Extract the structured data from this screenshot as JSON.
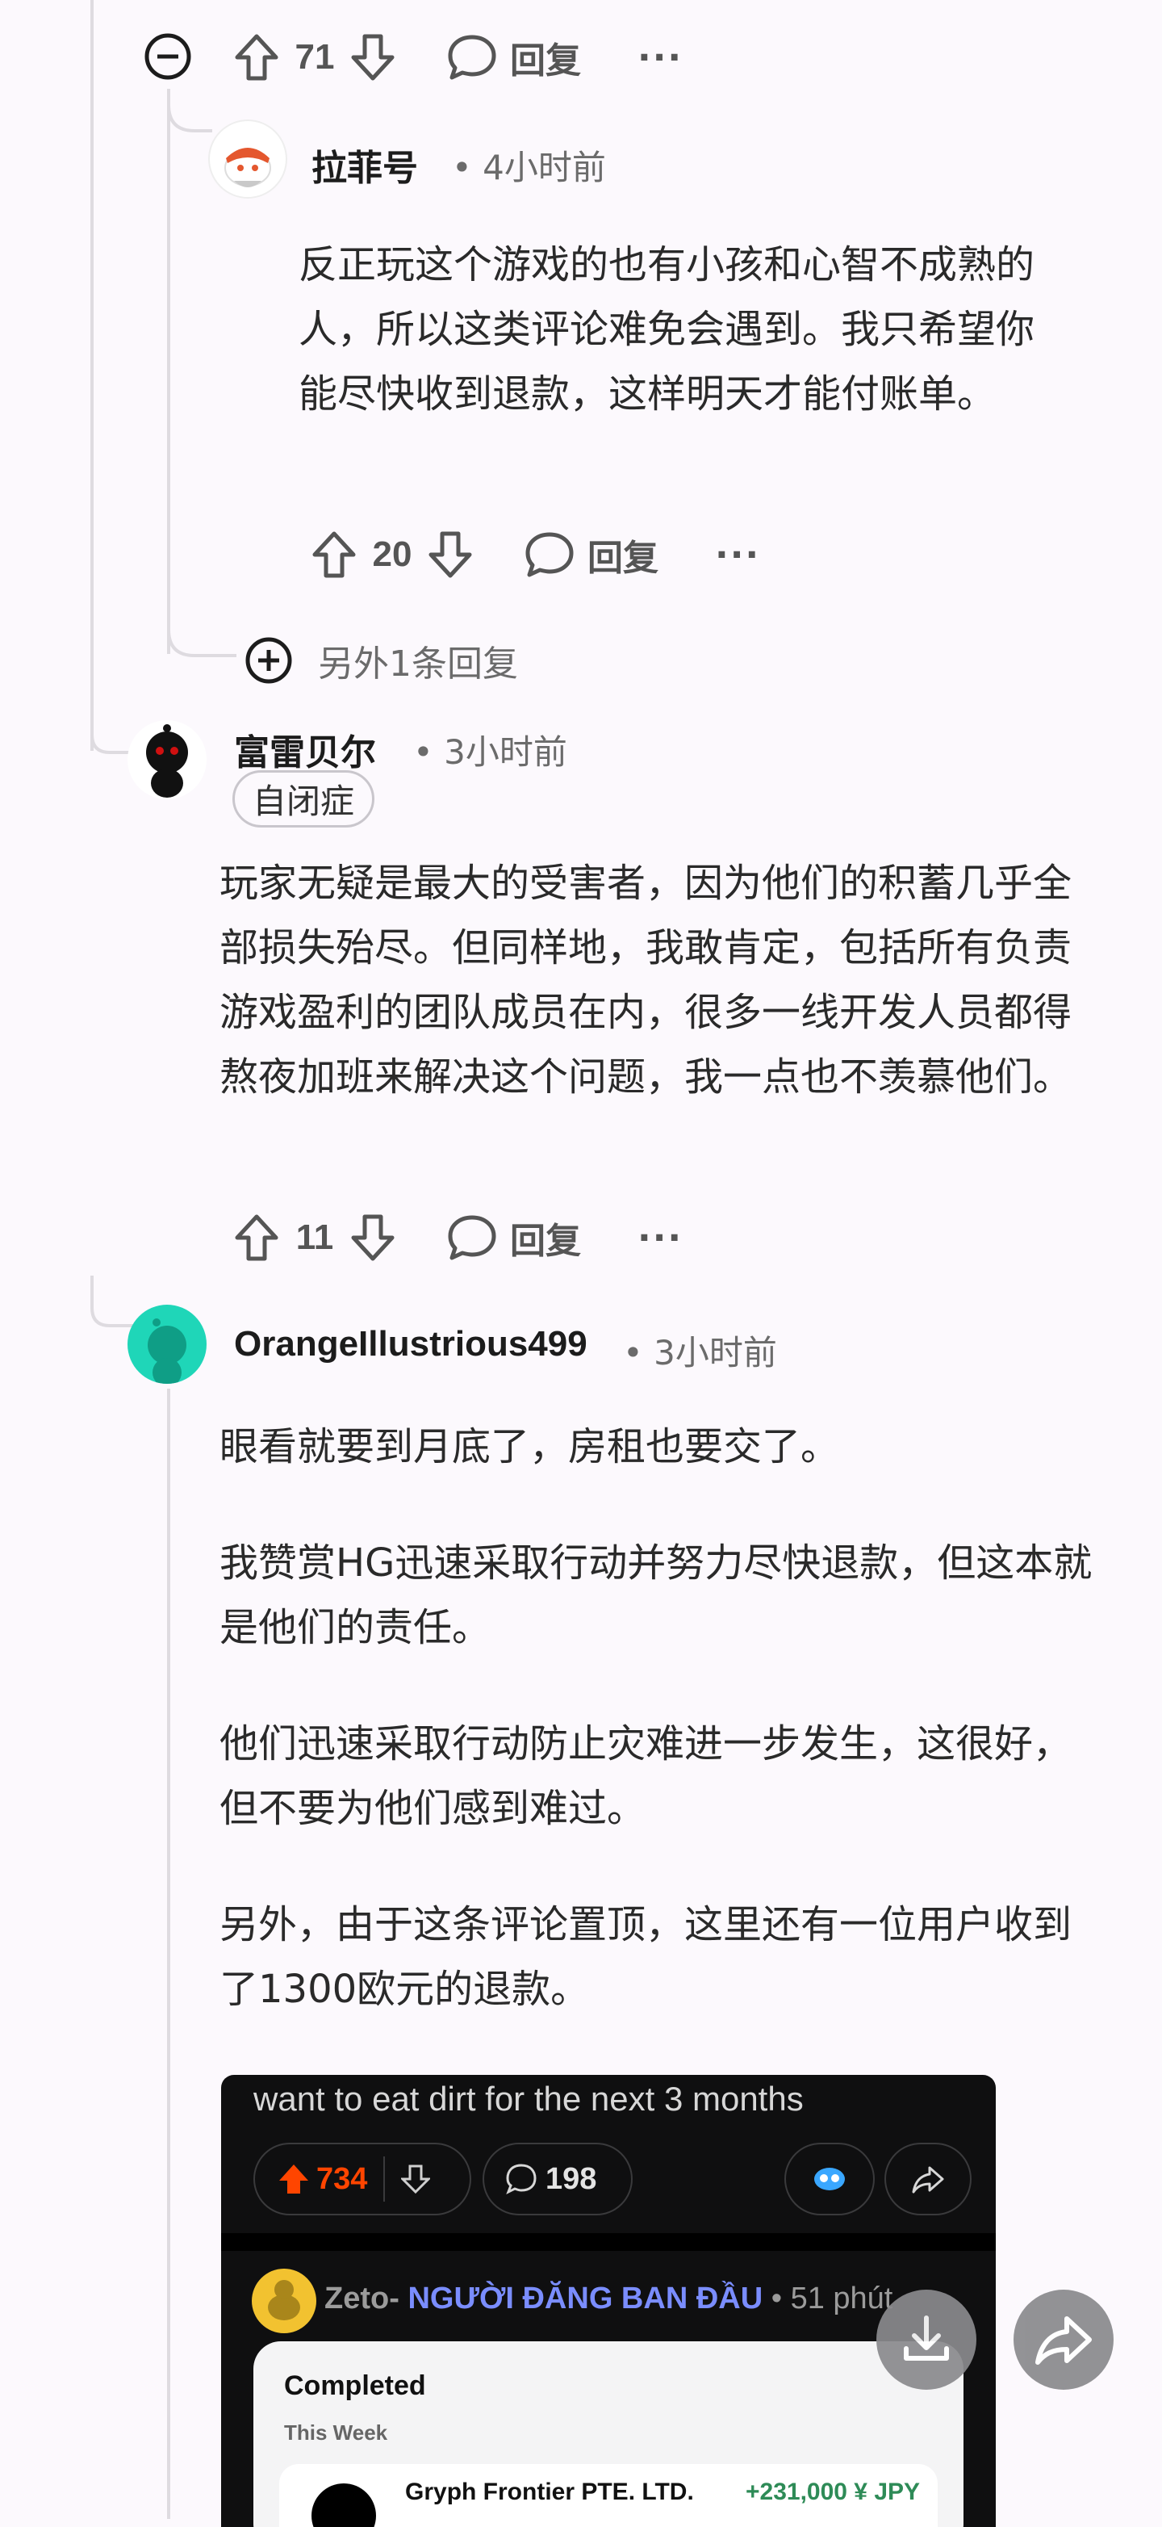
{
  "comments": [
    {
      "votes": "71",
      "reply_label": "回复",
      "more": "···"
    },
    {
      "username": "拉菲号",
      "time": "• 4小时前",
      "text": "反正玩这个游戏的也有小孩和心智不成熟的人，所以这类评论难免会遇到。我只希望你能尽快收到退款，这样明天才能付账单。",
      "votes": "20",
      "reply_label": "回复",
      "more": "···"
    },
    {
      "more_replies": "另外1条回复"
    },
    {
      "username": "富雷贝尔",
      "time": "• 3小时前",
      "flair": "自闭症",
      "text": "玩家无疑是最大的受害者，因为他们的积蓄几乎全部损失殆尽。但同样地，我敢肯定，包括所有负责游戏盈利的团队成员在内，很多一线开发人员都得熬夜加班来解决这个问题，我一点也不羡慕他们。",
      "votes": "11",
      "reply_label": "回复",
      "more": "···"
    },
    {
      "username": "OrangeIllustrious499",
      "time": "• 3小时前",
      "paragraphs": [
        "眼看就要到月底了，房租也要交了。",
        "我赞赏HG迅速采取行动并努力尽快退款，但这本就是他们的责任。",
        "他们迅速采取行动防止灾难进一步发生，这很好，但不要为他们感到难过。",
        "另外，由于这条评论置顶，这里还有一位用户收到了1300欧元的退款。"
      ]
    }
  ],
  "embed": {
    "title": "want to eat dirt for the next 3 months",
    "upvotes": "734",
    "comments": "198",
    "author": "Zeto-",
    "op_badge": "NGƯỜI ĐĂNG BAN ĐẦU",
    "time": "• 51 phút",
    "card_title": "Completed",
    "card_subtitle": "This Week",
    "tx_name": "Gryph Frontier PTE. LTD.",
    "tx_amount": "+231,000 ¥ JPY"
  },
  "colors": {
    "accent_orange": "#ff4500",
    "op_blue": "#7a8dff",
    "tx_green": "#2e8b57"
  }
}
